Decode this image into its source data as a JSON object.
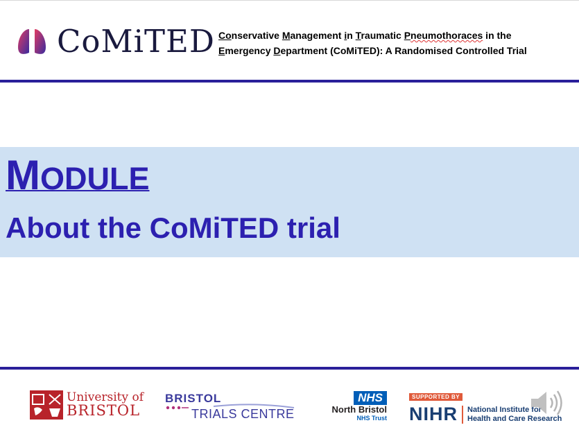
{
  "header": {
    "logo_text": "CoMiTED",
    "title_line1": [
      "Co",
      "nservative ",
      "M",
      "anagement ",
      "i",
      "n ",
      "T",
      "raumatic ",
      "P",
      "neumothoraces",
      " in the"
    ],
    "title_line2": [
      "E",
      "mergency ",
      "D",
      "epartment (CoMiTED): A Randomised Controlled Trial"
    ]
  },
  "module": {
    "first_letter": "M",
    "rest": "ODULE",
    "subtitle": "About the CoMiTED trial"
  },
  "footer": {
    "uob_line1": "University of",
    "uob_line2": "BRISTOL",
    "btc_line1": "BRISTOL",
    "btc_line2": "TRIALS CENTRE",
    "nhs_badge": "NHS",
    "nhs_line1": "North Bristol",
    "nhs_line2": "NHS Trust",
    "nihr_supported": "SUPPORTED BY",
    "nihr_big": "NIHR",
    "nihr_line1": "National Institute for",
    "nihr_line2": "Health and Care Research"
  },
  "colors": {
    "accent": "#2c20b0",
    "rule": "#2a1f9a",
    "band": "#cfe1f3"
  }
}
